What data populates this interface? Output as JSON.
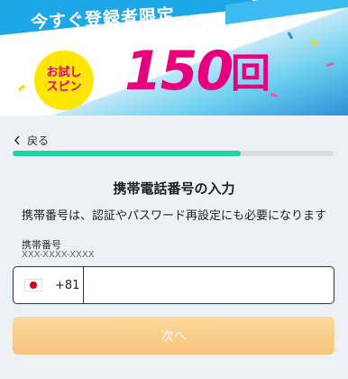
{
  "banner": {
    "title": "今すぐ登録者限定",
    "badge_line1": "お試し",
    "badge_line2": "スピン",
    "count": "150",
    "unit": "回"
  },
  "nav": {
    "back_label": "戻る"
  },
  "progress": {
    "value_percent": 71
  },
  "form": {
    "heading": "携帯電話番号の入力",
    "description": "携帯番号は、認証やパスワード再設定にも必要になります",
    "field_label": "携帯番号",
    "field_hint": "XXX-XXXX-XXXX",
    "country_flag": "japan-flag-icon",
    "dial_code": "+81",
    "phone_value": "",
    "next_label": "次へ"
  },
  "colors": {
    "accent_green": "#1ed3a2",
    "brand_pink": "#e6007e",
    "banner_blue": "#1ea7e8",
    "button_disabled": "#f6c47d"
  }
}
